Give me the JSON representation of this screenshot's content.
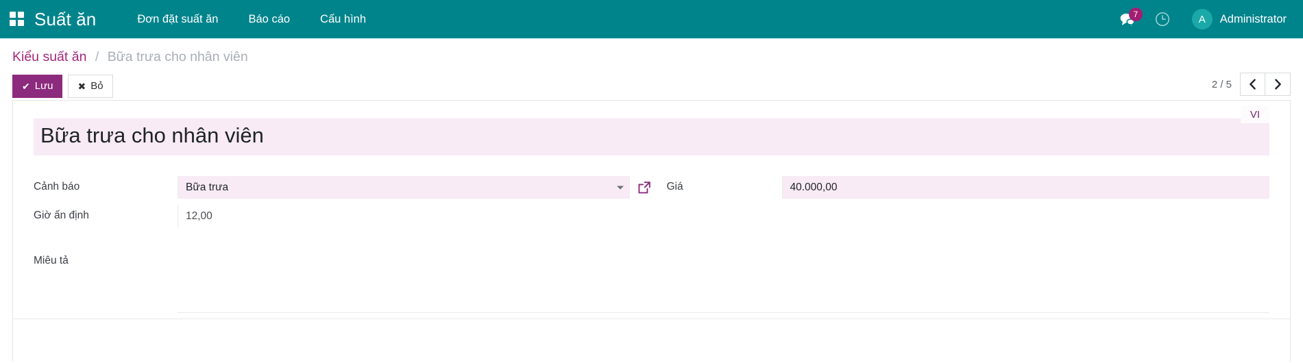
{
  "navbar": {
    "apps_icon": "apps-grid-icon",
    "brand": "Suất ăn",
    "menu": [
      {
        "label": "Đơn đặt suất ăn"
      },
      {
        "label": "Báo cáo"
      },
      {
        "label": "Cấu hình"
      }
    ],
    "messages_icon": "chat-bubble-icon",
    "messages_count": "7",
    "activity_icon": "clock-icon",
    "avatar_initial": "A",
    "username": "Administrator",
    "bg_color": "#00848c",
    "badge_color": "#a31e73"
  },
  "breadcrumb": {
    "parent": "Kiểu suất ăn",
    "separator": "/",
    "current": "Bữa trưa cho nhân viên",
    "link_color": "#a4277c"
  },
  "toolbar": {
    "save_label": "Lưu",
    "save_icon": "check-icon",
    "discard_label": "Bỏ",
    "discard_icon": "cross-icon",
    "save_color": "#8c2a7d"
  },
  "pager": {
    "label": "2 / 5",
    "prev_icon": "chevron-left-icon",
    "next_icon": "chevron-right-icon"
  },
  "form": {
    "title_value": "Bữa trưa cho nhân viên",
    "title_placeholder": "",
    "lang_badge": "VI",
    "dirty_bg": "#f8ebf5",
    "fields": {
      "warning": {
        "label": "Cảnh báo",
        "value": "Bữa trưa",
        "caret_icon": "chevron-down-icon",
        "open_icon": "external-link-icon"
      },
      "fixed_hour": {
        "label": "Giờ ấn định",
        "value": "12,00"
      },
      "price": {
        "label": "Giá",
        "value": "40.000,00"
      },
      "description": {
        "label": "Miêu tả",
        "value": ""
      }
    }
  }
}
